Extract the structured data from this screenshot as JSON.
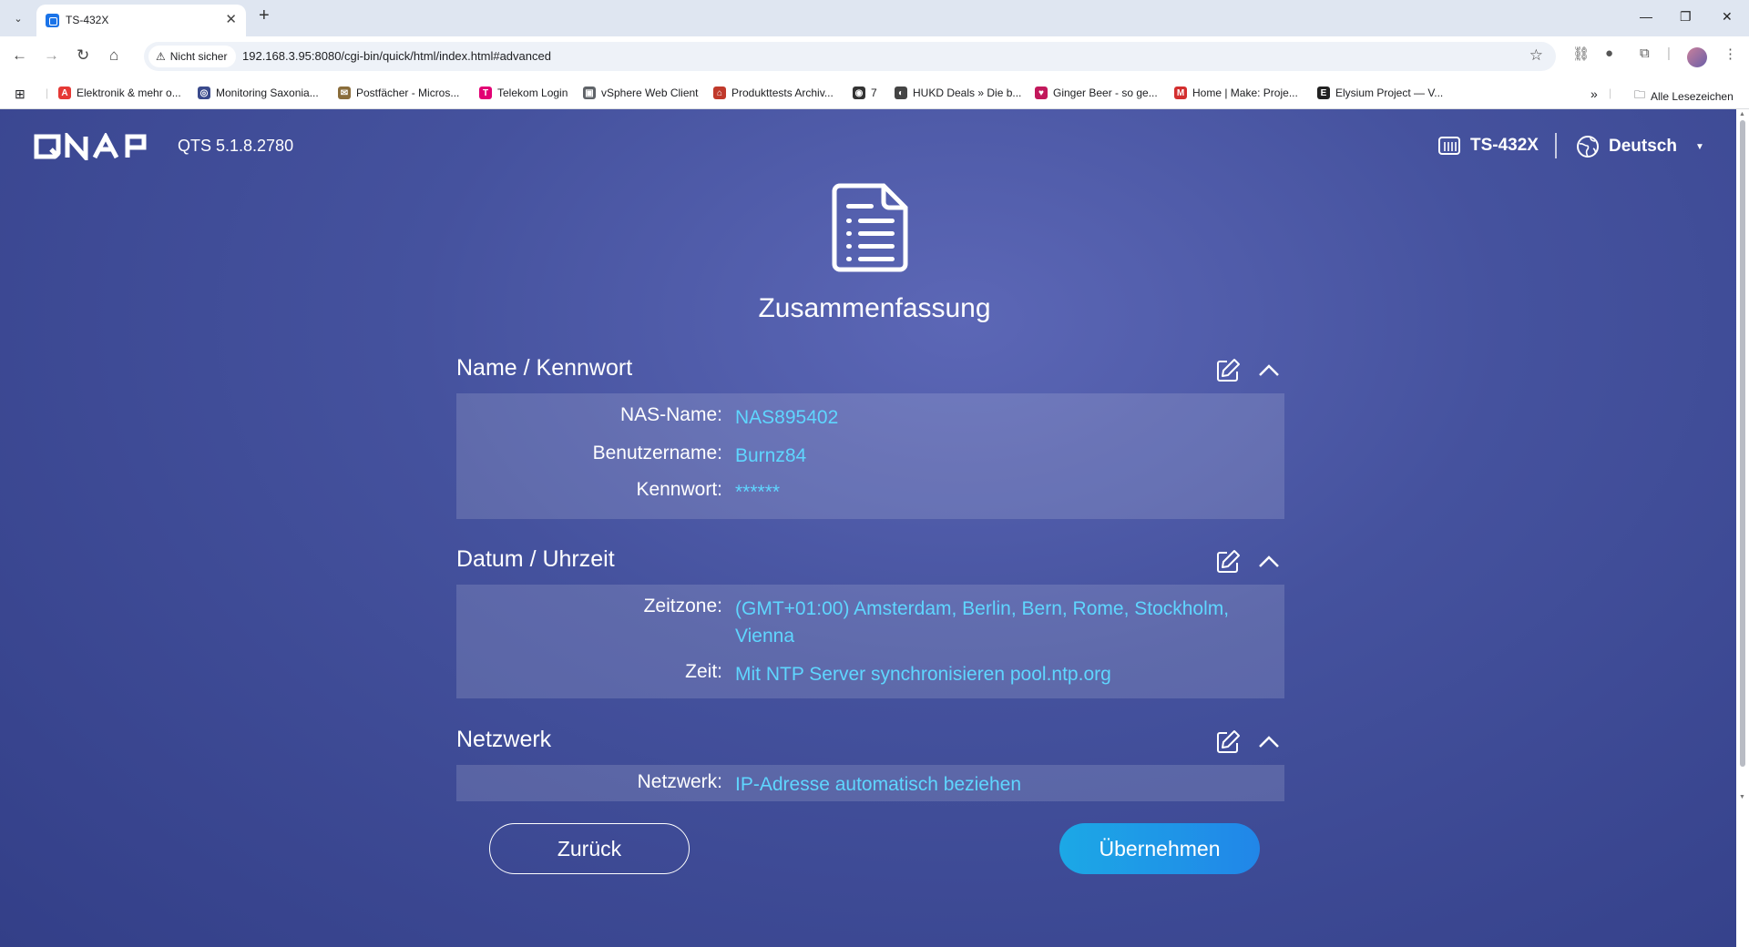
{
  "browser": {
    "tab_title": "TS-432X",
    "tab_close": "✕",
    "new_tab": "+",
    "security_label": "Nicht sicher",
    "url": "192.168.3.95:8080/cgi-bin/quick/html/index.html#advanced",
    "bookmarks": [
      {
        "label": "Elektronik & mehr o...",
        "icon": "A",
        "color": "#e53935"
      },
      {
        "label": "Monitoring Saxonia...",
        "icon": "◎",
        "color": "#3a4a8c"
      },
      {
        "label": "Postfächer - Micros...",
        "icon": "✉",
        "color": "#8a6d3b"
      },
      {
        "label": "Telekom Login",
        "icon": "T",
        "color": "#e20074"
      },
      {
        "label": "vSphere Web Client",
        "icon": "▣",
        "color": "#5f6368"
      },
      {
        "label": "Produkttests Archiv...",
        "icon": "⌂",
        "color": "#c0392b"
      },
      {
        "label": "7",
        "icon": "◉",
        "color": "#333333"
      },
      {
        "label": "HUKD Deals » Die b...",
        "icon": "◐",
        "color": "#444444"
      },
      {
        "label": "Ginger Beer - so ge...",
        "icon": "♥",
        "color": "#c2185b"
      },
      {
        "label": "Home | Make: Proje...",
        "icon": "M",
        "color": "#d32f2f"
      },
      {
        "label": "Elysium Project — V...",
        "icon": "E",
        "color": "#222222"
      }
    ],
    "all_bookmarks": "Alle Lesezeichen",
    "more_bookmarks": "»"
  },
  "header": {
    "brand": "QNAP",
    "version": "QTS 5.1.8.2780",
    "device_name": "TS-432X",
    "language": "Deutsch"
  },
  "summary": {
    "title": "Zusammenfassung",
    "sections": [
      {
        "title": "Name / Kennwort",
        "rows": [
          {
            "label": "NAS-Name:",
            "value": "NAS895402"
          },
          {
            "label": "Benutzername:",
            "value": "Burnz84"
          },
          {
            "label": "Kennwort:",
            "value": "******"
          }
        ]
      },
      {
        "title": "Datum / Uhrzeit",
        "rows": [
          {
            "label": "Zeitzone:",
            "value": "(GMT+01:00) Amsterdam, Berlin, Bern, Rome, Stockholm, Vienna"
          },
          {
            "label": "Zeit:",
            "value": "Mit NTP Server synchronisieren pool.ntp.org"
          }
        ]
      },
      {
        "title": "Netzwerk",
        "rows": [
          {
            "label": "Netzwerk:",
            "value": "IP-Adresse automatisch beziehen"
          }
        ]
      }
    ]
  },
  "actions": {
    "back": "Zurück",
    "apply": "Übernehmen"
  },
  "colors": {
    "accent": "#5fd6ff",
    "apply_gradient_start": "#1ca8e6",
    "apply_gradient_end": "#2186e8",
    "page_background": "#45529e"
  }
}
